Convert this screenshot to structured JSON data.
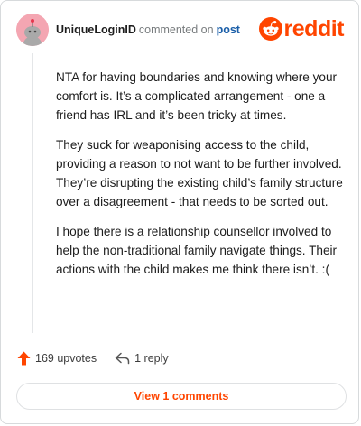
{
  "header": {
    "username": "UniqueLoginID",
    "commented_text": "commented on",
    "post_link": "post"
  },
  "logo": {
    "wordmark": "reddit",
    "icon": "reddit-snoo-icon",
    "color": "#ff4500"
  },
  "comment": {
    "paragraphs": [
      "NTA for having boundaries and knowing where your comfort is. It’s a complicated arrangement - one a friend has IRL and it’s been tricky at times.",
      "They suck for weaponising access to the child, providing a reason to not want to be further involved. They’re disrupting the existing child’s family structure over a disagreement - that needs to be sorted out.",
      "I hope there is a relationship counsellor involved to help the non-traditional family navigate things. Their actions with the child makes me think there isn’t. :("
    ]
  },
  "actions": {
    "upvotes_label": "169 upvotes",
    "upvote_icon": "upvote-arrow-icon",
    "reply_label": "1 reply",
    "reply_icon": "reply-arrow-icon"
  },
  "view_button": {
    "label": "View 1 comments"
  },
  "colors": {
    "accent": "#ff4500",
    "link": "#1a5ea8",
    "muted": "#787c7e"
  }
}
